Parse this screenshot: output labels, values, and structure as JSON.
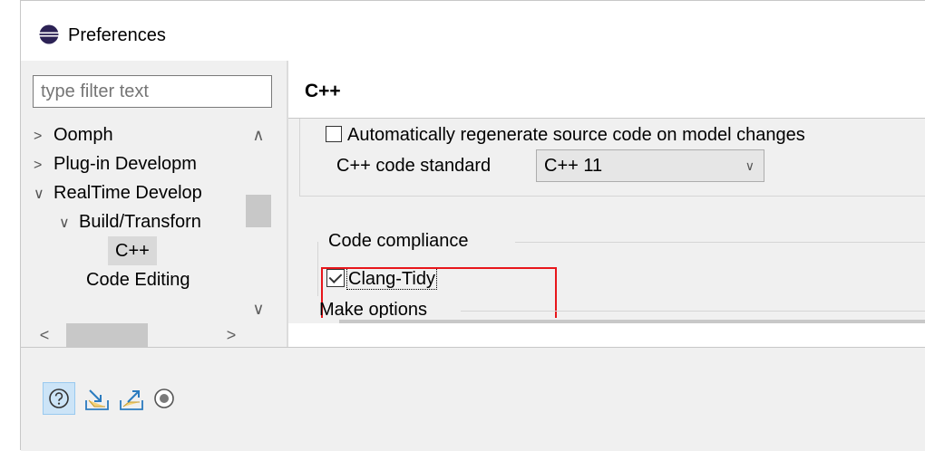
{
  "window": {
    "title": "Preferences",
    "icon": "eclipse-icon"
  },
  "filter": {
    "placeholder": "type filter text"
  },
  "tree": {
    "items": [
      {
        "label": "Oomph",
        "twisty": "collapsed"
      },
      {
        "label": "Plug-in Developm",
        "twisty": "collapsed"
      },
      {
        "label": "RealTime Develop",
        "twisty": "expanded"
      },
      {
        "label": "Build/Transforn",
        "twisty": "expanded"
      },
      {
        "label": "C++",
        "selected": true
      },
      {
        "label": "Code Editing"
      }
    ],
    "scroll_up_icon": "chevron-up-icon",
    "scroll_down_icon": "chevron-down-icon",
    "scroll_left_icon": "chevron-left-icon",
    "scroll_right_icon": "chevron-right-icon"
  },
  "page": {
    "title": "C++",
    "regenerate_label": "Automatically regenerate source code on model changes",
    "standard_label": "C++ code standard",
    "standard_value": "C++ 11",
    "compliance_group": "Code compliance",
    "clang_tidy_label": "Clang-Tidy",
    "clang_tidy_checked": true,
    "make_group": "Make options",
    "highlight_color": "#e8161b"
  },
  "toolbar": {
    "buttons": [
      "help-icon",
      "import-icon",
      "export-icon",
      "record-icon"
    ]
  }
}
